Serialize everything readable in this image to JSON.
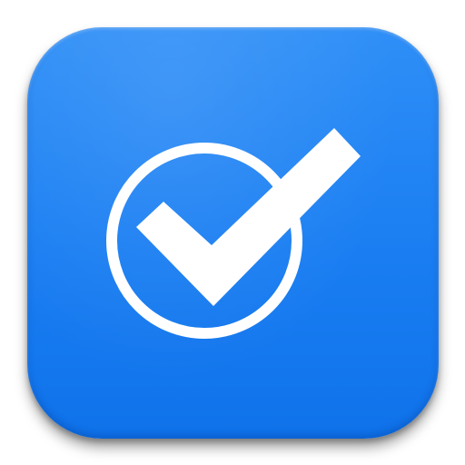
{
  "icon": {
    "name": "check-circle-icon",
    "tile_color": "#1a7ef2",
    "glyph_color": "#ffffff"
  }
}
